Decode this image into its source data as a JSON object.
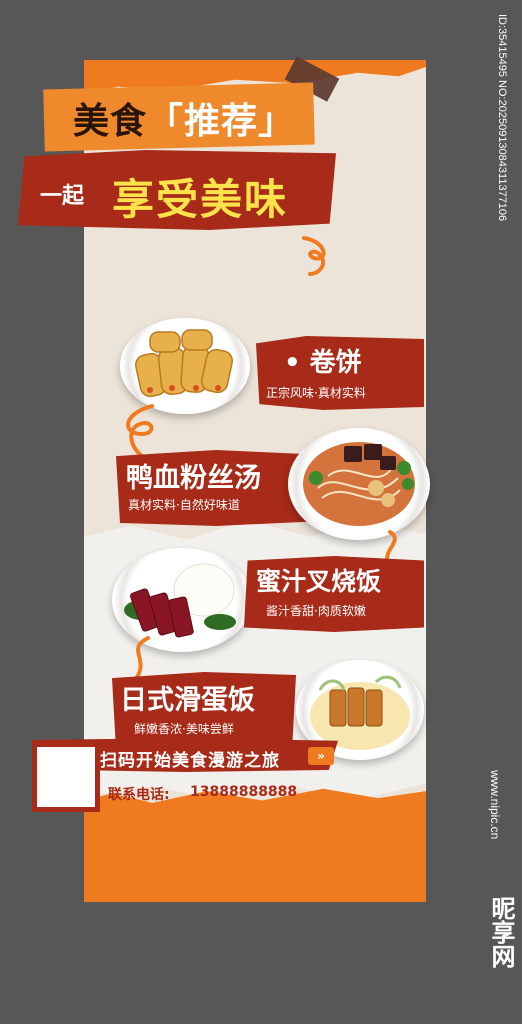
{
  "poster": {
    "title_pre": "美食",
    "title_bracket_open": "「",
    "title_highlight": "推荐",
    "title_bracket_close": "」",
    "subtitle_lead": "一起",
    "subtitle_main": "享受美味",
    "dishes": [
      {
        "name": "• 卷饼",
        "desc": "正宗风味·真材实料"
      },
      {
        "name": "鸭血粉丝汤",
        "desc": "真材实料·自然好味道"
      },
      {
        "name": "蜜汁叉烧饭",
        "desc": "酱汁香甜·肉质软嫩"
      },
      {
        "name": "日式滑蛋饭",
        "desc": "鲜嫩香浓·美味尝鲜"
      }
    ],
    "cta_text": "扫码开始美食漫游之旅",
    "cta_arrow": "»",
    "contact_label": "联系电话:",
    "contact_phone": "13888888888"
  },
  "watermark": {
    "id_text": "ID:35415495 NO:20250913084311377106",
    "site": "www.nipic.cn",
    "brand": "昵享网"
  },
  "colors": {
    "orange": "#f07a1f",
    "red": "#a82a18",
    "paper": "#ece4d8",
    "yellow": "#fce34a",
    "frame": "#575757"
  }
}
